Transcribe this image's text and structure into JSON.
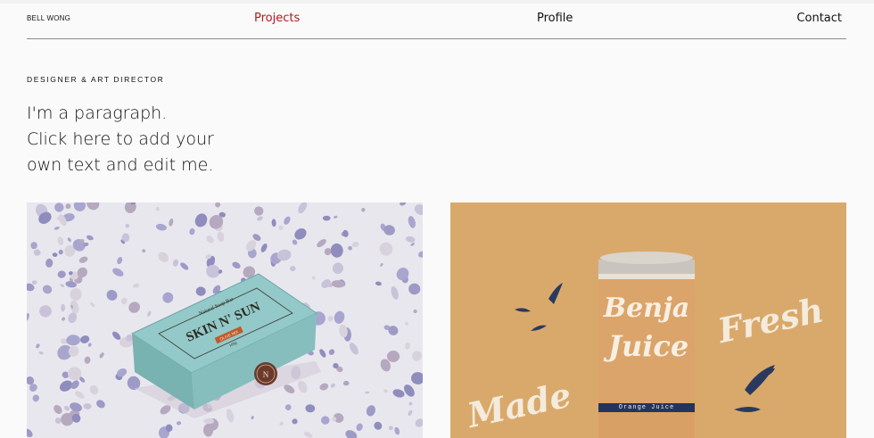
{
  "header": {
    "brand": "BELL WONG",
    "nav": [
      {
        "label": "Projects"
      },
      {
        "label": "Profile"
      },
      {
        "label": "Contact"
      }
    ]
  },
  "intro": {
    "kicker": "DESIGNER & ART DIRECTOR",
    "paragraph_lines": [
      "I'm a paragraph.",
      "Click here to add your",
      "own text and edit me."
    ]
  },
  "projects": [
    {
      "box_top_label": "Natural Soap Bar",
      "box_brand": "SKIN N' SUN",
      "box_sub_label": "OLIVE MIX",
      "box_weight": "100g",
      "box_seal": "N"
    },
    {
      "can_brand_line1": "Benja",
      "can_brand_line2": "Juice",
      "can_flavor": "Orange Juice",
      "word_left": "Made",
      "word_right": "Fresh"
    }
  ],
  "colors": {
    "accent": "#b4161b",
    "soap_box": "#8fc6c5",
    "juice_bg": "#d9a96b",
    "can_navy": "#23355f"
  }
}
